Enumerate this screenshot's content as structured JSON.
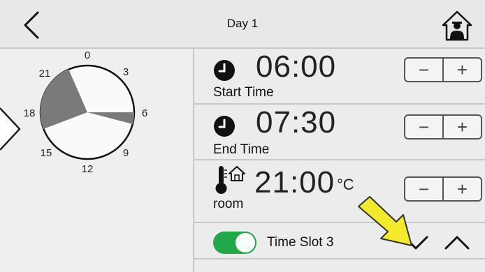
{
  "header": {
    "title": "Day 1",
    "back_icon": "chevron-left-icon",
    "home_icon": "home-person-icon"
  },
  "clock": {
    "labels": [
      "0",
      "3",
      "6",
      "9",
      "12",
      "15",
      "18",
      "21"
    ]
  },
  "rows": {
    "start": {
      "value": "06:00",
      "label": "Start Time",
      "icon": "clock-icon"
    },
    "end": {
      "value": "07:30",
      "label": "End Time",
      "icon": "clock-icon"
    },
    "temp": {
      "value": "21:00",
      "unit": "°C",
      "label": "room",
      "icon": "thermometer-home-icon"
    }
  },
  "stepper": {
    "minus": "−",
    "plus": "+"
  },
  "time_slot": {
    "label": "Time Slot 3",
    "enabled": true,
    "toggle_color": "#20a84a"
  },
  "colors": {
    "accent_green": "#20a84a",
    "clock_fill": "#7a7a7a",
    "annotation_arrow": "#f2ea2a"
  }
}
